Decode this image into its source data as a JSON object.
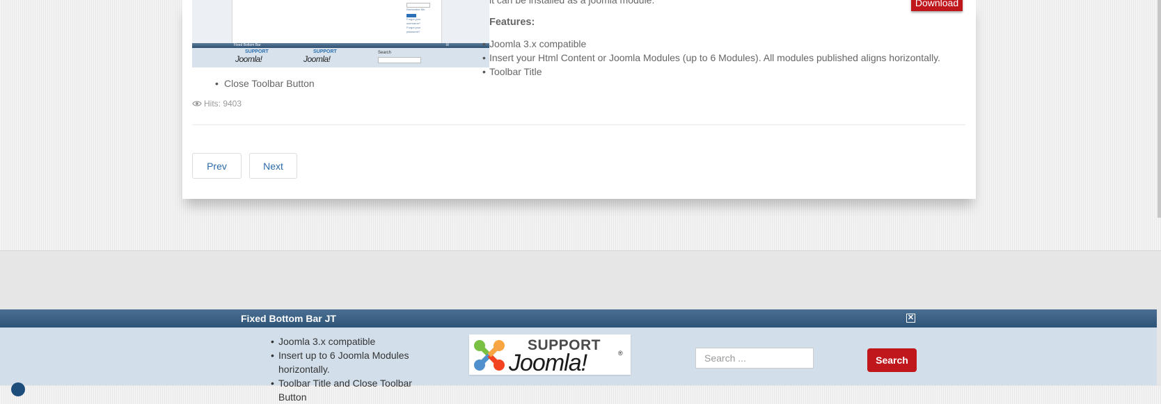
{
  "article": {
    "intro_text": "it can be installed as a joomla module.",
    "features_heading": "Features:",
    "features": [
      "Joomla 3.x compatible",
      "Insert your Html Content or Joomla Modules (up to 6 Modules). All modules published aligns horizontally.",
      "Toolbar Title"
    ],
    "extra_features": [
      "Close Toolbar Button"
    ],
    "hits": "Hits: 9403",
    "download_label": "Download"
  },
  "screenshot": {
    "bar_title": "Fixed Bottom Bar",
    "remember": "Remember Me",
    "login": "Log in",
    "forgot_user": "Forgot your username?",
    "forgot_pass": "Forgot your password?",
    "support_1": "SUPPORT",
    "joomla_1": "Joomla!",
    "support_2": "SUPPORT",
    "joomla_2": "Joomla!",
    "search_label": "Search",
    "search_placeholder": "Search..."
  },
  "pagination": {
    "prev": "Prev",
    "next": "Next"
  },
  "bottom_bar": {
    "title": "Fixed Bottom Bar JT",
    "close_glyph": "✕",
    "features": [
      "Joomla 3.x compatible",
      "Insert up to 6 Joomla Modules horizontally.",
      "Toolbar Title and Close Toolbar Button"
    ],
    "support_text": "SUPPORT",
    "joomla_text": "Joomla!",
    "joomla_reg": "®",
    "search_placeholder": "Search ...",
    "search_button": "Search"
  },
  "colors": {
    "accent_red": "#c0171d",
    "link_blue": "#2a6aa8",
    "bar_blue": "#2d5377",
    "bar_bg": "#d2dfeb"
  }
}
